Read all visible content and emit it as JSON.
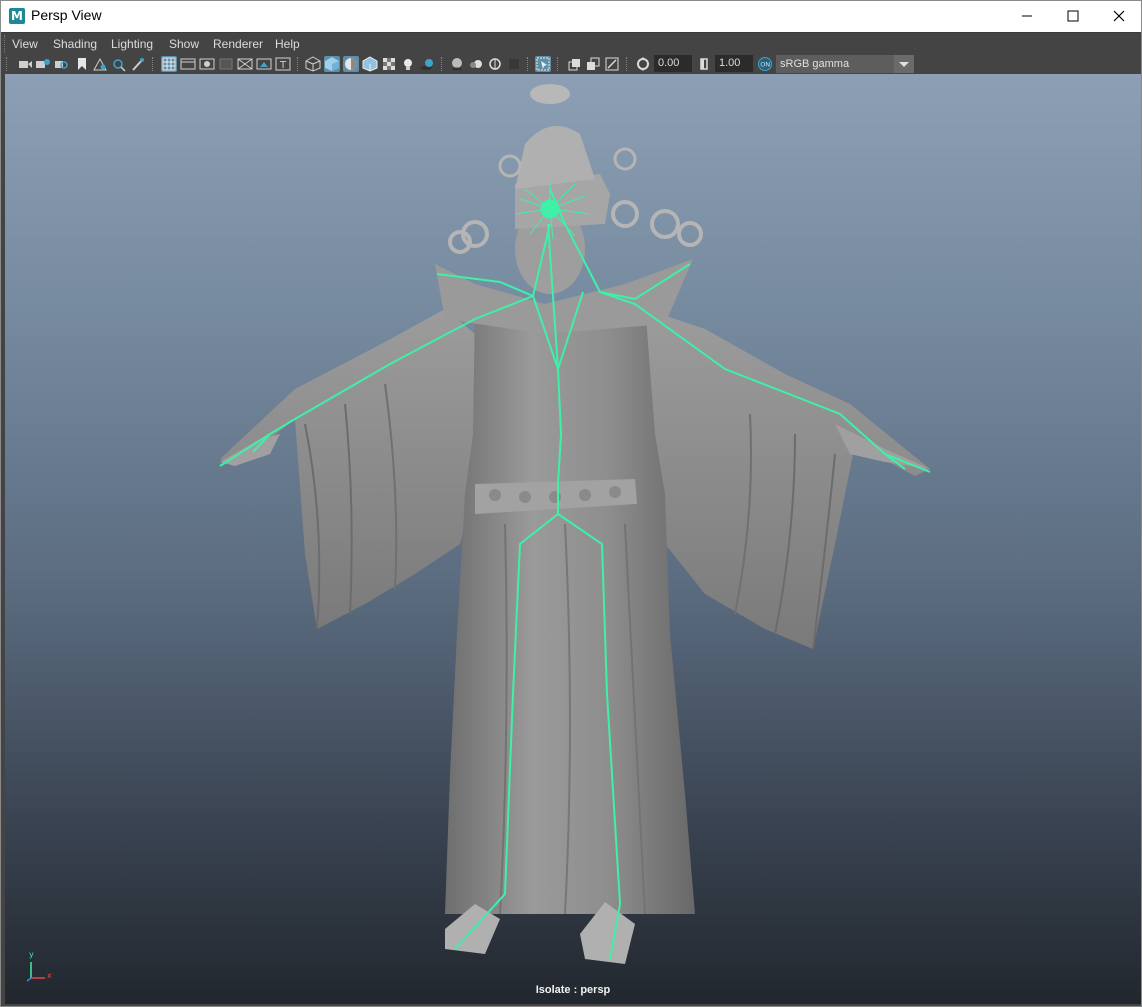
{
  "window": {
    "title": "Persp View",
    "app_icon_letter": "M"
  },
  "menu": {
    "items": [
      "View",
      "Shading",
      "Lighting",
      "Show",
      "Renderer",
      "Help"
    ]
  },
  "toolbar": {
    "exposure_value": "0.00",
    "gamma_value": "1.00",
    "color_management_label": "sRGB gamma",
    "icons": [
      "select-camera",
      "camera-attributes",
      "bookmarks",
      "image-plane",
      "grease-pencil",
      "2d-pan-zoom",
      "grid",
      "film-gate",
      "resolution-gate",
      "gate-mask",
      "field-chart",
      "safe-action",
      "safe-title",
      "wireframe",
      "smooth-shade",
      "use-default-material",
      "wireframe-on-shaded",
      "xray",
      "textured",
      "use-all-lights",
      "shadows",
      "screen-space-ao",
      "motion-blur",
      "multisample-aa",
      "depth-of-field",
      "isolate-select",
      "xray-joints",
      "xray-active-components",
      "exposure",
      "gamma",
      "color-management"
    ],
    "active_icons": [
      "grid",
      "smooth-shade",
      "use-default-material",
      "isolate-select"
    ]
  },
  "viewport": {
    "hud_label": "Isolate : persp",
    "axis_labels": {
      "x": "x",
      "y": "y"
    },
    "background_top": "#8c9fb4",
    "background_bottom": "#22272e",
    "mesh_color": "#8e8e8e",
    "joint_color": "#3ef0a8"
  }
}
